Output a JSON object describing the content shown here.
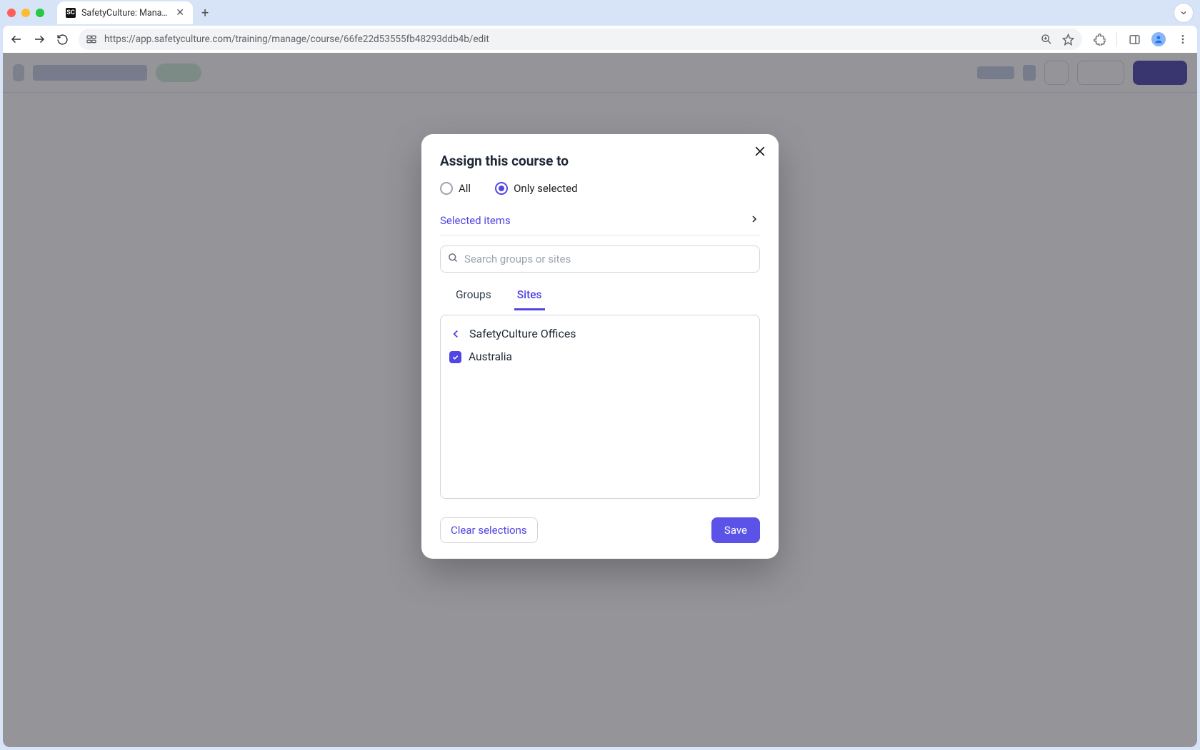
{
  "browser": {
    "tab_title": "SafetyCulture: Manage Teams and...",
    "url": "https://app.safetyculture.com/training/manage/course/66fe22d53555fb48293ddb4b/edit"
  },
  "modal": {
    "title": "Assign this course to",
    "radio_all": "All",
    "radio_only_selected": "Only selected",
    "selected_items_label": "Selected items",
    "search_placeholder": "Search groups or sites",
    "tabs": {
      "groups": "Groups",
      "sites": "Sites"
    },
    "breadcrumb": "SafetyCulture Offices",
    "items": [
      {
        "label": "Australia",
        "checked": true
      }
    ],
    "clear_label": "Clear selections",
    "save_label": "Save"
  }
}
